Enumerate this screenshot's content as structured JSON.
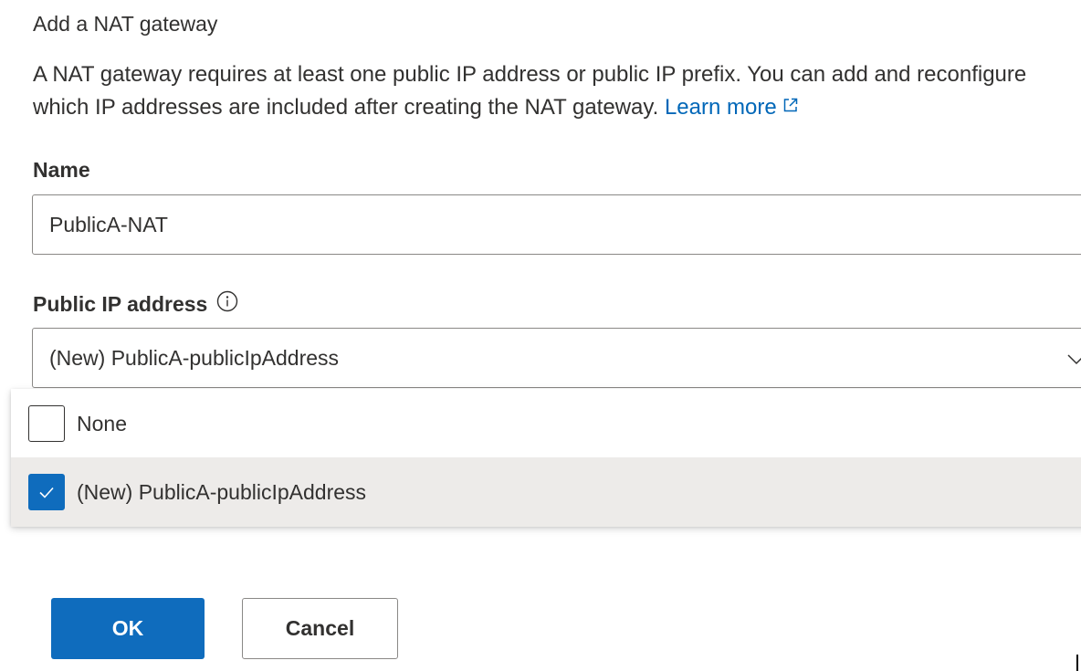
{
  "panel": {
    "title": "Add a NAT gateway",
    "description": "A NAT gateway requires at least one public IP address or public IP prefix. You can add and reconfigure which IP addresses are included after creating the NAT gateway.",
    "learn_more_label": "Learn more",
    "learn_more_icon": "external-link-icon"
  },
  "form": {
    "name_label": "Name",
    "name_value": "PublicA-NAT",
    "ip_label": "Public IP address",
    "ip_info_icon": "info-icon",
    "ip_selected": "(New) PublicA-publicIpAddress",
    "ip_chevron_icon": "chevron-down-icon"
  },
  "dropdown": {
    "options": [
      {
        "label": "None",
        "checked": false
      },
      {
        "label": "(New) PublicA-publicIpAddress",
        "checked": true
      }
    ]
  },
  "buttons": {
    "ok_label": "OK",
    "cancel_label": "Cancel"
  },
  "colors": {
    "accent": "#0f6cbd",
    "link": "#0067b8",
    "selected_row": "#edebe9",
    "border": "#8a8886"
  }
}
